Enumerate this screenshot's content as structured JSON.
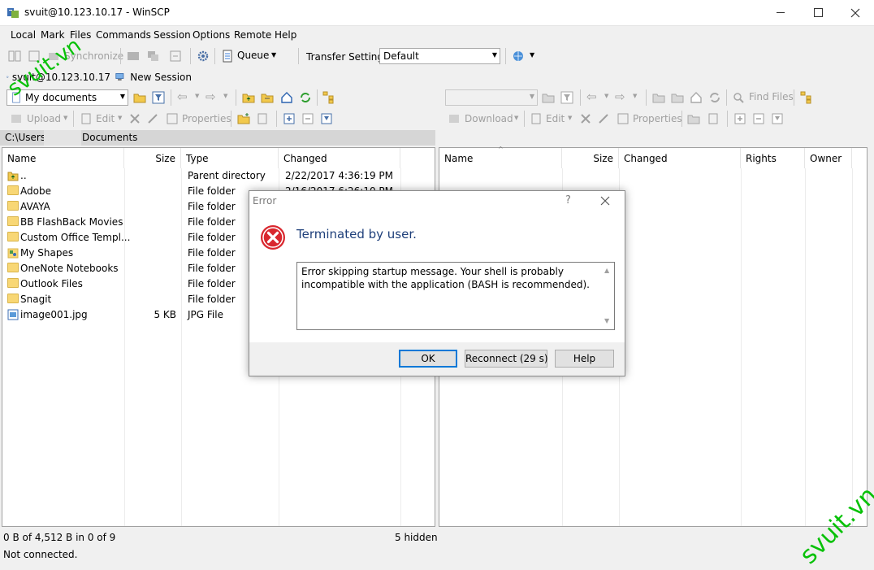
{
  "window": {
    "title": "svuit@10.123.10.17 - WinSCP"
  },
  "menu": [
    "Local",
    "Mark",
    "Files",
    "Commands",
    "Session",
    "Options",
    "Remote",
    "Help"
  ],
  "toolbar": {
    "synchronize": "Synchronize",
    "queue": "Queue",
    "transfer_settings_label": "Transfer Settings",
    "transfer_settings_value": "Default"
  },
  "tabs": {
    "session": "svuit@10.123.10.17",
    "new_session": "New Session"
  },
  "local": {
    "location": "My documents",
    "upload": "Upload",
    "edit": "Edit",
    "properties": "Properties",
    "path_prefix": "C:\\Users\\",
    "path_suffix": "Documents",
    "columns": [
      "Name",
      "Size",
      "Type",
      "Changed"
    ],
    "rows": [
      {
        "name": "..",
        "size": "",
        "type": "Parent directory",
        "changed": "2/22/2017  4:36:19 PM",
        "icon": "parent-dir-icon"
      },
      {
        "name": "Adobe",
        "size": "",
        "type": "File folder",
        "changed": "2/16/2017  6:26:10 PM",
        "icon": "folder-icon"
      },
      {
        "name": "AVAYA",
        "size": "",
        "type": "File folder",
        "changed": "",
        "icon": "folder-icon"
      },
      {
        "name": "BB FlashBack Movies",
        "size": "",
        "type": "File folder",
        "changed": "",
        "icon": "folder-icon"
      },
      {
        "name": "Custom Office Templ...",
        "size": "",
        "type": "File folder",
        "changed": "",
        "icon": "folder-icon"
      },
      {
        "name": "My Shapes",
        "size": "",
        "type": "File folder",
        "changed": "",
        "icon": "shapes-folder-icon"
      },
      {
        "name": "OneNote Notebooks",
        "size": "",
        "type": "File folder",
        "changed": "",
        "icon": "folder-icon"
      },
      {
        "name": "Outlook Files",
        "size": "",
        "type": "File folder",
        "changed": "",
        "icon": "folder-icon"
      },
      {
        "name": "Snagit",
        "size": "",
        "type": "File folder",
        "changed": "",
        "icon": "folder-icon"
      },
      {
        "name": "image001.jpg",
        "size": "5 KB",
        "type": "JPG File",
        "changed": "",
        "icon": "image-file-icon"
      }
    ]
  },
  "remote": {
    "download": "Download",
    "edit": "Edit",
    "properties": "Properties",
    "find_files": "Find Files",
    "columns": [
      "Name",
      "Size",
      "Changed",
      "Rights",
      "Owner"
    ]
  },
  "status": {
    "selection": "0 B of 4,512 B in 0 of 9",
    "hidden": "5 hidden",
    "connection": "Not connected."
  },
  "dialog": {
    "title": "Error",
    "help_glyph": "?",
    "heading": "Terminated by user.",
    "message": "Error skipping startup message. Your shell is probably incompatible with the application (BASH is recommended).",
    "ok": "OK",
    "reconnect": "Reconnect (29 s)",
    "help": "Help"
  },
  "watermark": {
    "text": "svuit.vn"
  },
  "colors": {
    "heading": "#1e3f7a",
    "error_red": "#d9272e",
    "watermark": "#08c108",
    "path_bar": "#d6d6d6"
  }
}
